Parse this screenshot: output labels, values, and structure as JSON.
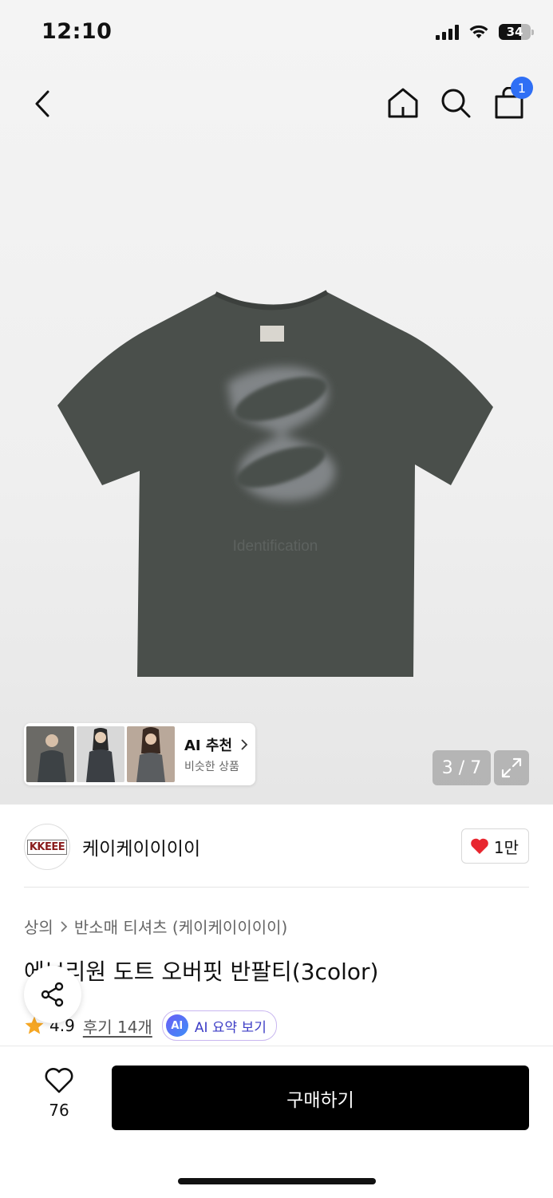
{
  "status_bar": {
    "time": "12:10",
    "battery": "34"
  },
  "nav": {
    "cart_count": "1"
  },
  "product_image": {
    "print_text": "Identification",
    "shirt_color": "#4a4f4b"
  },
  "ai_recommend": {
    "title": "AI 추천",
    "subtitle": "비슷한 상품"
  },
  "gallery": {
    "pager": "3 / 7"
  },
  "brand": {
    "logo_text": "KKEEE",
    "name": "케이케이이이이",
    "like_count": "1만"
  },
  "breadcrumb": {
    "category": "상의",
    "subcategory": "반소매 티셔츠 (케이케이이이이)"
  },
  "product": {
    "title": "에브리원 도트 오버핏 반팔티(3color)",
    "rating": "4.9",
    "reviews": "후기 14개"
  },
  "ai_summary": {
    "badge": "AI",
    "label": "AI 요약 보기"
  },
  "bottom": {
    "wish_count": "76",
    "buy_label": "구매하기"
  },
  "colors": {
    "accent_blue": "#2f6ff5",
    "heart_red": "#e8262f",
    "star": "#f5a623",
    "buy_bg": "#000000"
  }
}
